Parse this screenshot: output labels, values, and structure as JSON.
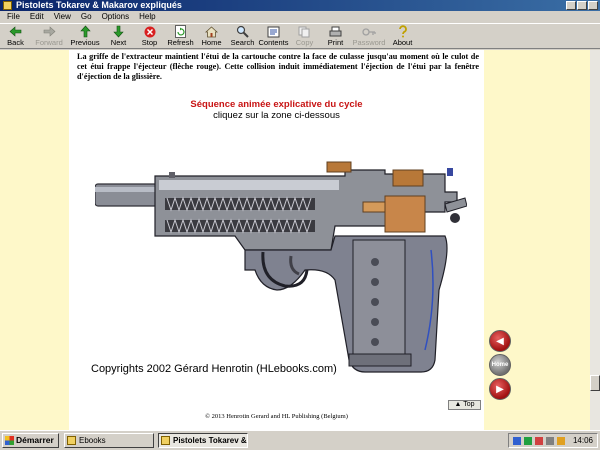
{
  "window": {
    "title": "Pistolets Tokarev & Makarov expliqués"
  },
  "menu": [
    "File",
    "Edit",
    "View",
    "Go",
    "Options",
    "Help"
  ],
  "toolbar": [
    {
      "name": "back-button",
      "label": "Back",
      "icon": "back-arrow-icon",
      "enabled": true
    },
    {
      "name": "forward-button",
      "label": "Forward",
      "icon": "forward-arrow-icon",
      "enabled": false
    },
    {
      "name": "previous-button",
      "label": "Previous",
      "icon": "up-arrow-icon",
      "enabled": true
    },
    {
      "name": "next-button",
      "label": "Next",
      "icon": "down-arrow-icon",
      "enabled": true
    },
    {
      "name": "stop-button",
      "label": "Stop",
      "icon": "stop-icon",
      "enabled": true
    },
    {
      "name": "refresh-button",
      "label": "Refresh",
      "icon": "refresh-icon",
      "enabled": true
    },
    {
      "name": "home-button",
      "label": "Home",
      "icon": "home-icon",
      "enabled": true
    },
    {
      "name": "search-button",
      "label": "Search",
      "icon": "search-icon",
      "enabled": true
    },
    {
      "name": "contents-button",
      "label": "Contents",
      "icon": "contents-icon",
      "enabled": true
    },
    {
      "name": "copy-button",
      "label": "Copy",
      "icon": "copy-icon",
      "enabled": false
    },
    {
      "name": "print-button",
      "label": "Print",
      "icon": "print-icon",
      "enabled": true
    },
    {
      "name": "password-button",
      "label": "Password",
      "icon": "key-icon",
      "enabled": false
    },
    {
      "name": "about-button",
      "label": "About",
      "icon": "about-icon",
      "enabled": true
    }
  ],
  "page": {
    "intro_text": "La griffe de l'extracteur maintient l'étui de la cartouche contre la face de culasse jusqu'au moment où le culot de cet étui frappe l'éjecteur (flèche rouge). Cette collision induit immédiatement l'éjection de l'étui par la fenêtre d'éjection de la glissière.",
    "sequence_title": "Séquence animée explicative du cycle",
    "sequence_subtitle": "cliquez sur la zone ci-dessous",
    "image_caption": "Copyrights 2002 Gérard Henrotin (HLebooks.com)",
    "footer": "© 2013   Henrotin Gerard and HL Publishing (Belgium)",
    "top_button": "Top"
  },
  "side_nav": {
    "home_label": "Home"
  },
  "taskbar": {
    "start": "Démarrer",
    "tasks": [
      "Ebooks",
      "Pistolets Tokarev & ..."
    ],
    "clock": "14:06"
  },
  "colors": {
    "page_bg": "#fef8c9",
    "sequence_title": "#c81414",
    "titlebar": "#0a246a"
  }
}
